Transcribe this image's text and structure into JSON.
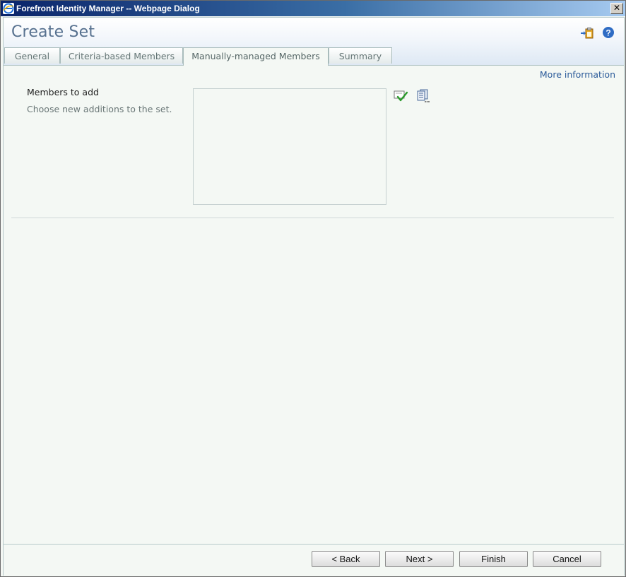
{
  "window": {
    "title": "Forefront Identity Manager -- Webpage Dialog",
    "close_label": "✕"
  },
  "page": {
    "title": "Create Set"
  },
  "header_icons": [
    {
      "name": "paste-icon",
      "accent": "#e0a020"
    },
    {
      "name": "help-icon",
      "accent": "#2f6cc4"
    }
  ],
  "tabs": [
    {
      "label": "General",
      "active": false
    },
    {
      "label": "Criteria-based Members",
      "active": false
    },
    {
      "label": "Manually-managed Members",
      "active": true
    },
    {
      "label": "Summary",
      "active": false
    }
  ],
  "links": {
    "more_information": "More information"
  },
  "members_field": {
    "label": "Members to add",
    "description": "Choose new additions to the set.",
    "value": ""
  },
  "member_actions": [
    {
      "name": "validate-icon"
    },
    {
      "name": "browse-icon"
    }
  ],
  "buttons": {
    "back": "< Back",
    "next": "Next >",
    "finish": "Finish",
    "cancel": "Cancel"
  },
  "colors": {
    "title_blue": "#57718f",
    "link_blue": "#2a5a99",
    "content_bg": "#f4f8f4"
  }
}
